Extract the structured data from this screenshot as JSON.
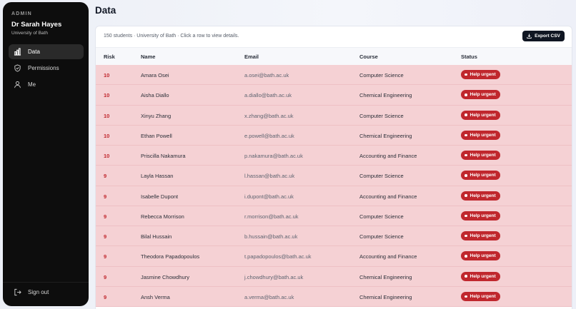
{
  "sidebar": {
    "role": "ADMIN",
    "user_name": "Dr Sarah Hayes",
    "university": "University of Bath",
    "items": [
      {
        "label": "Data",
        "icon": "bar-chart-icon",
        "active": true
      },
      {
        "label": "Permissions",
        "icon": "shield-icon",
        "active": false
      },
      {
        "label": "Me",
        "icon": "user-icon",
        "active": false
      }
    ],
    "signout_label": "Sign out"
  },
  "main": {
    "title": "Data",
    "summary": "150 students · University of Bath · Click a row to view details.",
    "export_label": "Export CSV",
    "columns": [
      "Risk",
      "Name",
      "Email",
      "Course",
      "Status"
    ],
    "rows": [
      {
        "risk": "10",
        "name": "Amara Osei",
        "email": "a.osei@bath.ac.uk",
        "course": "Computer Science",
        "status": "Help urgent"
      },
      {
        "risk": "10",
        "name": "Aisha Diallo",
        "email": "a.diallo@bath.ac.uk",
        "course": "Chemical Engineering",
        "status": "Help urgent"
      },
      {
        "risk": "10",
        "name": "Xinyu Zhang",
        "email": "x.zhang@bath.ac.uk",
        "course": "Computer Science",
        "status": "Help urgent"
      },
      {
        "risk": "10",
        "name": "Ethan Powell",
        "email": "e.powell@bath.ac.uk",
        "course": "Chemical Engineering",
        "status": "Help urgent"
      },
      {
        "risk": "10",
        "name": "Priscilla Nakamura",
        "email": "p.nakamura@bath.ac.uk",
        "course": "Accounting and Finance",
        "status": "Help urgent"
      },
      {
        "risk": "9",
        "name": "Layla Hassan",
        "email": "l.hassan@bath.ac.uk",
        "course": "Computer Science",
        "status": "Help urgent"
      },
      {
        "risk": "9",
        "name": "Isabelle Dupont",
        "email": "i.dupont@bath.ac.uk",
        "course": "Accounting and Finance",
        "status": "Help urgent"
      },
      {
        "risk": "9",
        "name": "Rebecca Morrison",
        "email": "r.morrison@bath.ac.uk",
        "course": "Computer Science",
        "status": "Help urgent"
      },
      {
        "risk": "9",
        "name": "Bilal Hussain",
        "email": "b.hussain@bath.ac.uk",
        "course": "Computer Science",
        "status": "Help urgent"
      },
      {
        "risk": "9",
        "name": "Theodora Papadopoulos",
        "email": "t.papadopoulos@bath.ac.uk",
        "course": "Accounting and Finance",
        "status": "Help urgent"
      },
      {
        "risk": "9",
        "name": "Jasmine Chowdhury",
        "email": "j.chowdhury@bath.ac.uk",
        "course": "Chemical Engineering",
        "status": "Help urgent"
      },
      {
        "risk": "9",
        "name": "Ansh Verma",
        "email": "a.verma@bath.ac.uk",
        "course": "Chemical Engineering",
        "status": "Help urgent"
      }
    ]
  },
  "colors": {
    "sidebar_bg": "#0d0d0d",
    "urgent_row": "#f5d1d4",
    "urgent_badge": "#c0272d",
    "button_bg": "#101622"
  }
}
